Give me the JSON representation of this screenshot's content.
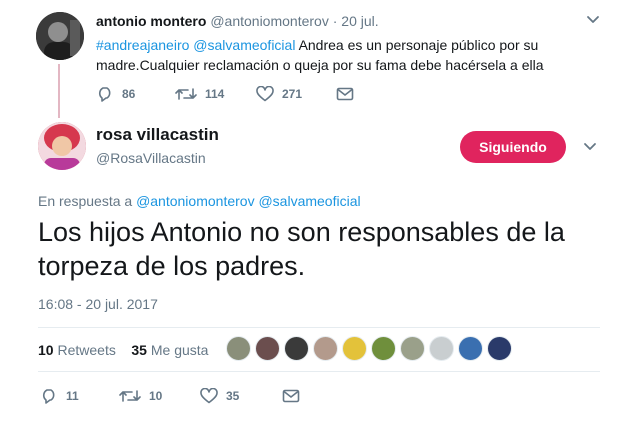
{
  "parent_tweet": {
    "name": "antonio montero",
    "handle": "@antoniomonterov",
    "separator": "·",
    "date": "20 jul.",
    "hashtag": "#andreajaneiro",
    "mention": "@salvameoficial",
    "text_line1": "Andrea es un personaje público por su",
    "text_line2": "madre.Cualquier reclamación o queja por su fama debe hacérsela a ella",
    "replies": "86",
    "retweets": "114",
    "likes": "271"
  },
  "main_tweet": {
    "name": "rosa villacastin",
    "handle": "@RosaVillacastin",
    "follow_button": "Siguiendo",
    "reply_prefix": "En respuesta a",
    "reply_mention_1": "@antoniomonterov",
    "reply_mention_2": "@salvameoficial",
    "text": "Los hijos Antonio no son responsables de la torpeza de los padres.",
    "timestamp": "16:08 - 20 jul. 2017",
    "retweet_count": "10",
    "retweet_label": "Retweets",
    "like_count": "35",
    "like_label": "Me gusta",
    "replies": "11",
    "retweets": "10",
    "likes": "35"
  },
  "colors": {
    "link": "#1b95e0",
    "follow_button": "#e0245e",
    "thread_line": "#e3b7c3",
    "muted_text": "#657786"
  },
  "liker_avatar_colors": [
    "#8a8f7a",
    "#6b4e4e",
    "#3a3a3a",
    "#b39a8c",
    "#e3c23a",
    "#6f8f3c",
    "#9aa08a",
    "#c9ced0",
    "#3a6fb0",
    "#2a3a6a"
  ]
}
